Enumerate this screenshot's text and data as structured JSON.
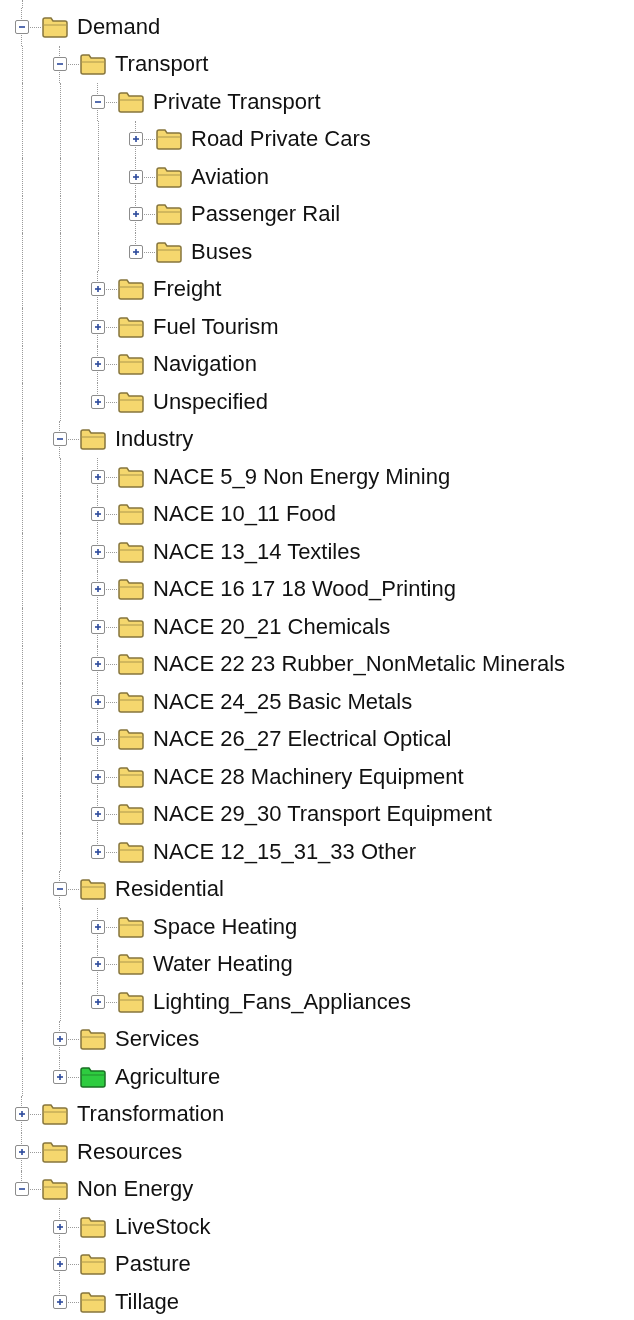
{
  "tree": [
    {
      "label": "Demand",
      "expanded": true,
      "color": "#f5d76e",
      "children": [
        {
          "label": "Transport",
          "expanded": true,
          "color": "#f5d76e",
          "children": [
            {
              "label": "Private Transport",
              "expanded": true,
              "color": "#f5d76e",
              "children": [
                {
                  "label": "Road Private Cars",
                  "expanded": false,
                  "color": "#f5d76e"
                },
                {
                  "label": "Aviation",
                  "expanded": false,
                  "color": "#f5d76e"
                },
                {
                  "label": "Passenger Rail",
                  "expanded": false,
                  "color": "#f5d76e"
                },
                {
                  "label": "Buses",
                  "expanded": false,
                  "color": "#f5d76e"
                }
              ]
            },
            {
              "label": "Freight",
              "expanded": false,
              "color": "#f5d76e"
            },
            {
              "label": "Fuel Tourism",
              "expanded": false,
              "color": "#f5d76e"
            },
            {
              "label": "Navigation",
              "expanded": false,
              "color": "#f5d76e"
            },
            {
              "label": "Unspecified",
              "expanded": false,
              "color": "#f5d76e"
            }
          ]
        },
        {
          "label": "Industry",
          "expanded": true,
          "color": "#f5d76e",
          "children": [
            {
              "label": "NACE 5_9 Non Energy Mining",
              "expanded": false,
              "color": "#f5d76e"
            },
            {
              "label": "NACE 10_11 Food",
              "expanded": false,
              "color": "#f5d76e"
            },
            {
              "label": "NACE 13_14 Textiles",
              "expanded": false,
              "color": "#f5d76e"
            },
            {
              "label": "NACE 16 17 18 Wood_Printing",
              "expanded": false,
              "color": "#f5d76e"
            },
            {
              "label": "NACE 20_21 Chemicals",
              "expanded": false,
              "color": "#f5d76e"
            },
            {
              "label": "NACE 22 23 Rubber_NonMetalic Minerals",
              "expanded": false,
              "color": "#f5d76e"
            },
            {
              "label": "NACE 24_25 Basic Metals",
              "expanded": false,
              "color": "#f5d76e"
            },
            {
              "label": "NACE 26_27 Electrical Optical",
              "expanded": false,
              "color": "#f5d76e"
            },
            {
              "label": "NACE 28 Machinery Equipment",
              "expanded": false,
              "color": "#f5d76e"
            },
            {
              "label": "NACE 29_30 Transport Equipment",
              "expanded": false,
              "color": "#f5d76e"
            },
            {
              "label": "NACE 12_15_31_33 Other",
              "expanded": false,
              "color": "#f5d76e"
            }
          ]
        },
        {
          "label": "Residential",
          "expanded": true,
          "color": "#f5d76e",
          "children": [
            {
              "label": "Space Heating",
              "expanded": false,
              "color": "#f5d76e"
            },
            {
              "label": "Water Heating",
              "expanded": false,
              "color": "#f5d76e"
            },
            {
              "label": "Lighting_Fans_Appliances",
              "expanded": false,
              "color": "#f5d76e"
            }
          ]
        },
        {
          "label": "Services",
          "expanded": false,
          "color": "#f5d76e"
        },
        {
          "label": "Agriculture",
          "expanded": false,
          "color": "#2ecc40"
        }
      ]
    },
    {
      "label": "Transformation",
      "expanded": false,
      "color": "#f5d76e"
    },
    {
      "label": "Resources",
      "expanded": false,
      "color": "#f5d76e"
    },
    {
      "label": "Non Energy",
      "expanded": true,
      "color": "#f5d76e",
      "children": [
        {
          "label": "LiveStock",
          "expanded": false,
          "color": "#f5d76e"
        },
        {
          "label": "Pasture",
          "expanded": false,
          "color": "#f5d76e"
        },
        {
          "label": "Tillage",
          "expanded": false,
          "color": "#f5d76e"
        }
      ]
    }
  ]
}
